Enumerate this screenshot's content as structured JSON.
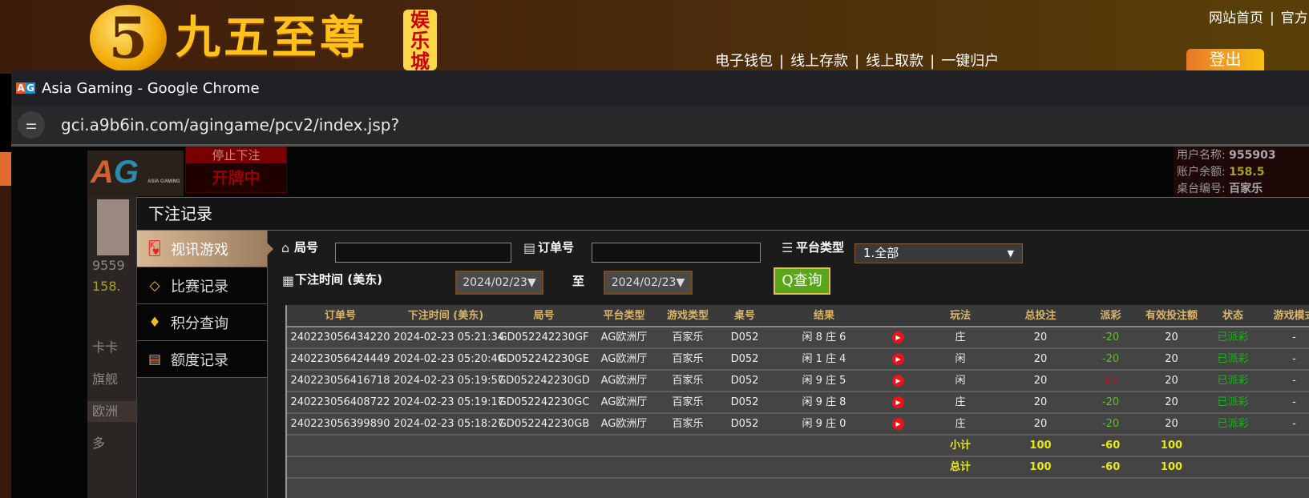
{
  "site": {
    "logo_digit": "5",
    "logo_text": "九五至尊",
    "logo_tag": "娱乐城",
    "top_links": [
      "网站首页",
      "官方"
    ],
    "nav": [
      "电子钱包",
      "线上存款",
      "线上取款",
      "一键归户"
    ],
    "logout": "登出"
  },
  "browser": {
    "favicon": [
      "A",
      "G"
    ],
    "title": "Asia Gaming - Google Chrome",
    "url": "gci.a9b6in.com/agingame/pcv2/index.jsp?"
  },
  "game": {
    "logo": [
      "A",
      "G"
    ],
    "logo_sub": "ASIA GAMING",
    "stop_label": "停止下注",
    "status": "开牌中",
    "left_panel": [
      "9559",
      "158.",
      "卡卡",
      "旗舰",
      "欧洲",
      "多"
    ],
    "user_name_label": "用户名称:",
    "user_name": "955903",
    "balance_label": "账户余额:",
    "balance": "158.5",
    "table_label": "桌台编号:",
    "table_value": "百家乐"
  },
  "modal": {
    "title": "下注记录",
    "sidebar": [
      {
        "label": "视讯游戏",
        "icon": "cards-icon"
      },
      {
        "label": "比赛记录",
        "icon": "ticket-icon"
      },
      {
        "label": "积分查询",
        "icon": "diamond-icon"
      },
      {
        "label": "额度记录",
        "icon": "document-icon"
      }
    ],
    "filters": {
      "round_label": "局号",
      "round_value": "",
      "order_label": "订单号",
      "order_value": "",
      "platform_label": "平台类型",
      "platform_value": "1.全部",
      "time_label": "下注时间 (美东)",
      "date_from": "2024/02/23▼",
      "to_label": "至",
      "date_to": "2024/02/23▼",
      "query": "查询"
    },
    "columns": [
      "订单号",
      "下注时间 (美东)",
      "局号",
      "平台类型",
      "游戏类型",
      "桌号",
      "结果",
      "",
      "玩法",
      "总投注",
      "派彩",
      "有效投注额",
      "状态",
      "游戏模式"
    ],
    "rows": [
      [
        "240223056434220",
        "2024-02-23 05:21:34",
        "GD052242230GF",
        "AG欧洲厅",
        "百家乐",
        "D052",
        "闲 8 庄 6",
        "庄",
        "20",
        "-20",
        "20",
        "已派彩",
        "-"
      ],
      [
        "240223056424449",
        "2024-02-23 05:20:40",
        "GD052242230GE",
        "AG欧洲厅",
        "百家乐",
        "D052",
        "闲 1 庄 4",
        "闲",
        "20",
        "-20",
        "20",
        "已派彩",
        "-"
      ],
      [
        "240223056416718",
        "2024-02-23 05:19:57",
        "GD052242230GD",
        "AG欧洲厅",
        "百家乐",
        "D052",
        "闲 9 庄 5",
        "闲",
        "20",
        "20",
        "20",
        "已派彩",
        "-"
      ],
      [
        "240223056408722",
        "2024-02-23 05:19:17",
        "GD052242230GC",
        "AG欧洲厅",
        "百家乐",
        "D052",
        "闲 9 庄 8",
        "庄",
        "20",
        "-20",
        "20",
        "已派彩",
        "-"
      ],
      [
        "240223056399890",
        "2024-02-23 05:18:27",
        "GD052242230GB",
        "AG欧洲厅",
        "百家乐",
        "D052",
        "闲 9 庄 0",
        "庄",
        "20",
        "-20",
        "20",
        "已派彩",
        "-"
      ]
    ],
    "subtotal": {
      "label": "小计",
      "bet": "100",
      "payout": "-60",
      "valid": "100"
    },
    "total": {
      "label": "总计",
      "bet": "100",
      "payout": "-60",
      "valid": "100"
    }
  }
}
